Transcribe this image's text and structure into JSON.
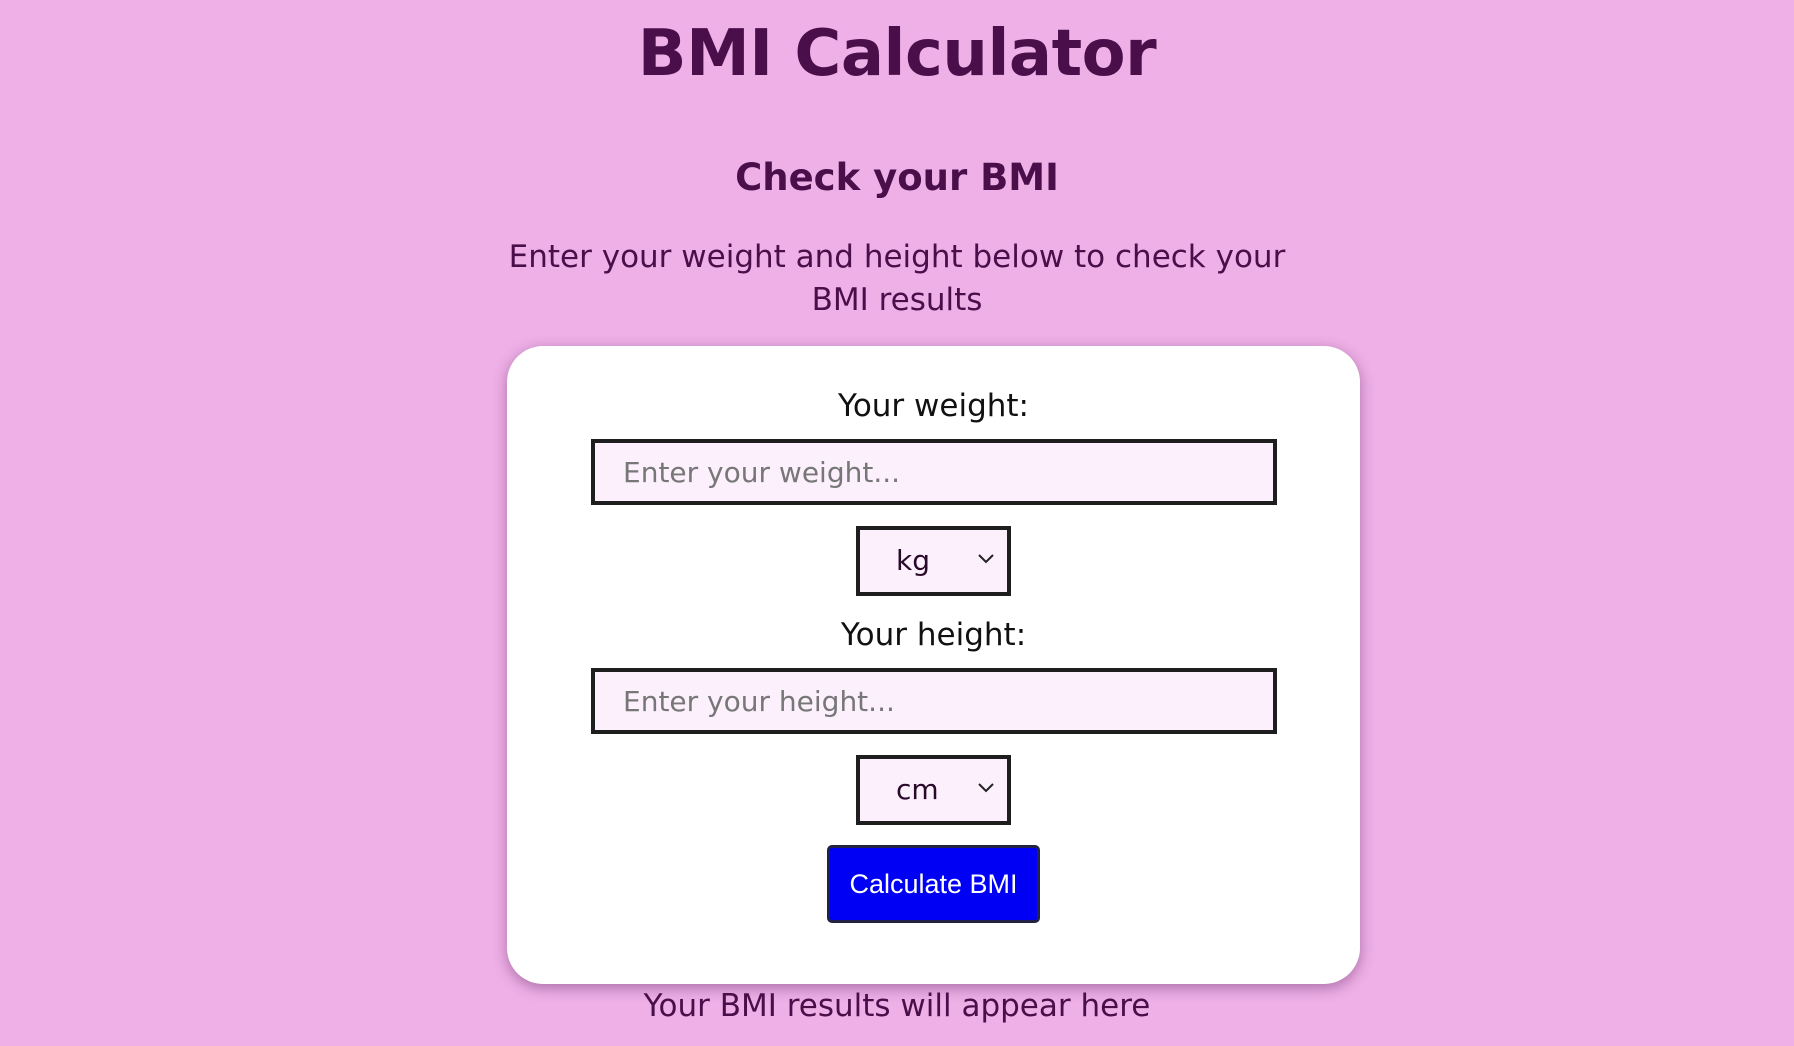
{
  "header": {
    "title": "BMI Calculator",
    "subtitle": "Check your BMI",
    "intro": "Enter your weight and height below to check your BMI results"
  },
  "form": {
    "weight_label": "Your weight:",
    "weight_placeholder": "Enter your weight...",
    "weight_value": "",
    "weight_unit": "kg",
    "height_label": "Your height:",
    "height_placeholder": "Enter your height...",
    "height_value": "",
    "height_unit": "cm",
    "button_label": "Calculate BMI"
  },
  "result": {
    "text": "Your BMI results will appear here"
  },
  "icons": {
    "select_arrow": "chevron-down-icon"
  },
  "colors": {
    "background": "#eeb0e6",
    "heading": "#4a0f4a",
    "card": "#ffffff",
    "field_bg": "#fcf0fc",
    "button": "#0000f5"
  }
}
